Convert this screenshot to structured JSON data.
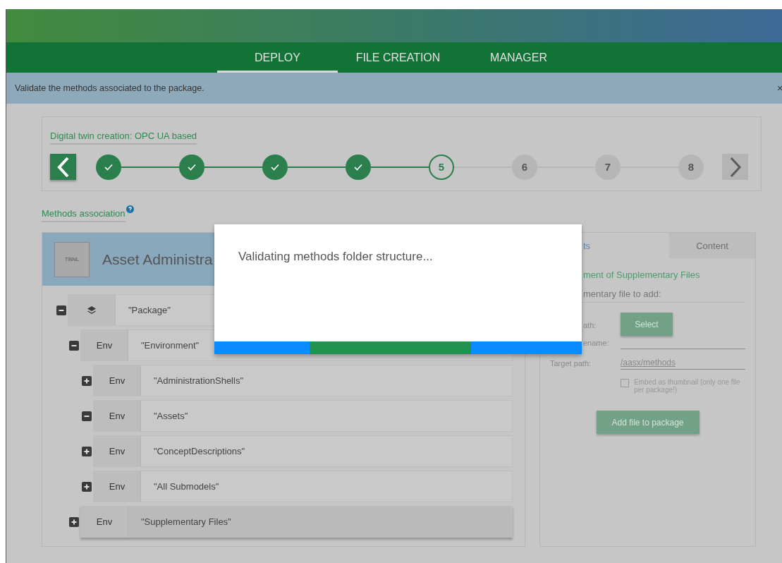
{
  "nav": {
    "tabs": [
      {
        "label": "DEPLOY",
        "selected": true
      },
      {
        "label": "FILE CREATION",
        "selected": false
      },
      {
        "label": "MANAGER",
        "selected": false
      }
    ]
  },
  "info_bar": {
    "message": "Validate the methods associated to the package.",
    "close": "×"
  },
  "stepper": {
    "title": "Digital twin creation: OPC UA based",
    "steps": [
      {
        "done": true,
        "current": false
      },
      {
        "done": true,
        "current": false
      },
      {
        "done": true,
        "current": false
      },
      {
        "done": true,
        "current": false
      },
      {
        "done": false,
        "current": true,
        "label": "5"
      },
      {
        "done": false,
        "current": false,
        "label": "6"
      },
      {
        "done": false,
        "current": false,
        "label": "7"
      },
      {
        "done": false,
        "current": false,
        "label": "8"
      }
    ]
  },
  "section_title": "Methods association",
  "asset_panel": {
    "thumbnail": "TBNL",
    "title": "Asset Administra",
    "tree": [
      {
        "kind": "package",
        "label": "\"Package\"",
        "expanded": true,
        "selected": false,
        "children": [
          {
            "kind": "env",
            "tag": "Env",
            "label": "\"Environment\"",
            "expanded": true,
            "selected": false,
            "children": [
              {
                "kind": "env",
                "tag": "Env",
                "label": "\"AdministrationShells\"",
                "expanded": false,
                "selected": false
              },
              {
                "kind": "env",
                "tag": "Env",
                "label": "\"Assets\"",
                "expanded": true,
                "selected": false
              },
              {
                "kind": "env",
                "tag": "Env",
                "label": "\"ConceptDescriptions\"",
                "expanded": false,
                "selected": false
              },
              {
                "kind": "env",
                "tag": "Env",
                "label": "\"All Submodels\"",
                "expanded": false,
                "selected": false
              }
            ]
          },
          {
            "kind": "env",
            "tag": "Env",
            "label": "\"Supplementary Files\"",
            "expanded": false,
            "selected": true
          }
        ]
      }
    ]
  },
  "side_panel": {
    "tabs": [
      {
        "label": "ts",
        "selected": true
      },
      {
        "label": "Content",
        "selected": false
      }
    ],
    "heading": "ment of Supplementary Files",
    "subheading": "mentary file to add:",
    "fields": [
      {
        "kind": "button",
        "label": "ath:",
        "button": "Select"
      },
      {
        "kind": "input",
        "label": "ename:"
      },
      {
        "kind": "input",
        "label": "Target path:",
        "value": "/aasx/methods"
      }
    ],
    "checkbox": {
      "label": "Embed as thumbnail (only one file per package!)",
      "checked": false
    },
    "add_button": "Add file to package"
  },
  "modal": {
    "message": "Validating methods folder structure...",
    "progress": {
      "level": 0.44
    }
  }
}
